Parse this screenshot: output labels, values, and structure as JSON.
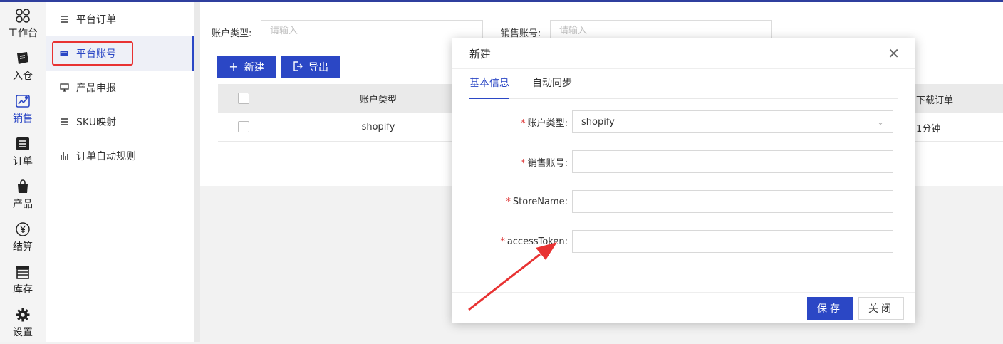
{
  "rail": [
    {
      "label": "工作台",
      "icon": "grid-icon"
    },
    {
      "label": "入仓",
      "icon": "inbound-icon"
    },
    {
      "label": "销售",
      "icon": "sales-icon",
      "active": true
    },
    {
      "label": "订单",
      "icon": "order-list-icon"
    },
    {
      "label": "产品",
      "icon": "bag-icon"
    },
    {
      "label": "结算",
      "icon": "yen-icon"
    },
    {
      "label": "库存",
      "icon": "storage-icon"
    },
    {
      "label": "设置",
      "icon": "gear-icon"
    }
  ],
  "submenu": [
    {
      "label": "平台订单",
      "icon": "list-icon"
    },
    {
      "label": "平台账号",
      "icon": "card-icon",
      "active": true
    },
    {
      "label": "产品申报",
      "icon": "monitor-icon"
    },
    {
      "label": "SKU映射",
      "icon": "list-icon"
    },
    {
      "label": "订单自动规则",
      "icon": "bars-icon"
    }
  ],
  "filters": {
    "account_type_label": "账户类型:",
    "account_type_placeholder": "请输入",
    "sales_account_label": "销售账号:",
    "sales_account_placeholder": "请输入"
  },
  "toolbar": {
    "new_label": "新建",
    "export_label": "导出"
  },
  "table": {
    "headers": {
      "account_type": "账户类型",
      "download": "下载订单"
    },
    "rows": [
      {
        "account_type": "shopify",
        "download": "1分钟"
      }
    ]
  },
  "modal": {
    "title": "新建",
    "tabs": [
      "基本信息",
      "自动同步"
    ],
    "fields": {
      "account_type": {
        "label": "账户类型:",
        "value": "shopify"
      },
      "sales_account": {
        "label": "销售账号:",
        "value": ""
      },
      "store_name": {
        "label": "StoreName:",
        "value": ""
      },
      "access_token": {
        "label": "accessToken:",
        "value": ""
      }
    },
    "required_mark": "*",
    "save_label": "保存",
    "close_label": "关闭"
  },
  "colors": {
    "accent": "#2b47c5",
    "highlight": "#e83232",
    "required": "#e03c3c"
  }
}
